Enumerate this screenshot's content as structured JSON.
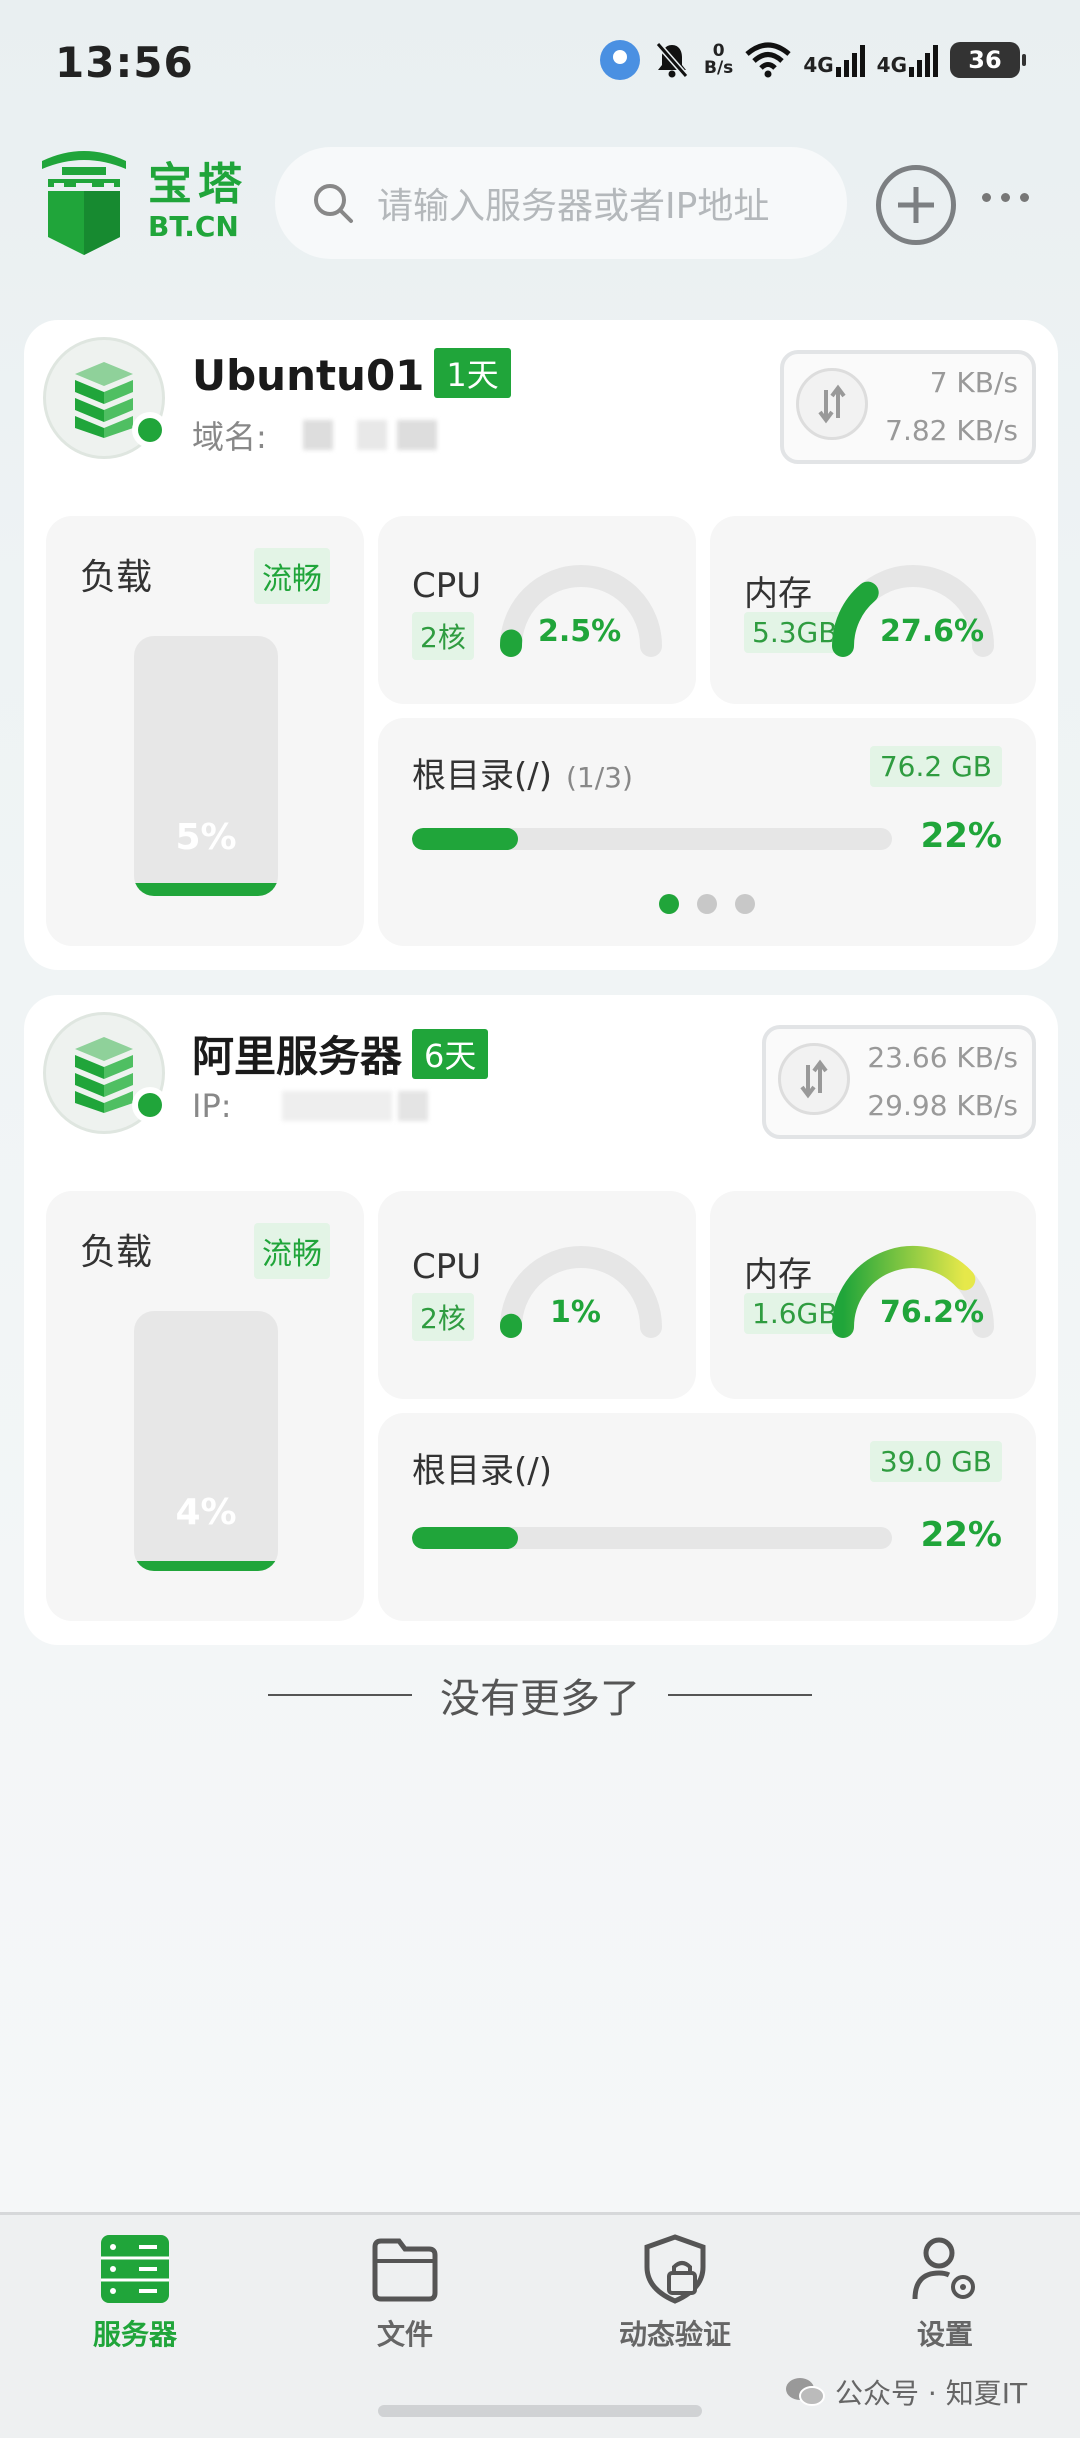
{
  "status_bar": {
    "time": "13:56",
    "net_speed_value": "0",
    "net_speed_unit": "B/s",
    "sim1_label": "4G",
    "sim2_label": "4G",
    "battery": "36"
  },
  "header": {
    "logo_cn": "宝塔",
    "logo_en": "BT.CN",
    "search_placeholder": "请输入服务器或者IP地址"
  },
  "servers": [
    {
      "name": "Ubuntu01",
      "days": "1天",
      "address_label": "域名:",
      "net_up": "7 KB/s",
      "net_down": "7.82 KB/s",
      "load": {
        "title": "负载",
        "status": "流畅",
        "percent": "5%",
        "fraction": 0.05
      },
      "cpu": {
        "title": "CPU",
        "cores": "2核",
        "percent": "2.5%",
        "fraction": 0.025
      },
      "memory": {
        "title": "内存",
        "size": "5.3GB",
        "percent": "27.6%",
        "fraction": 0.276
      },
      "disk": {
        "title": "根目录(/)",
        "page": "(1/3)",
        "size": "76.2 GB",
        "percent": "22%",
        "fraction": 0.22
      }
    },
    {
      "name": "阿里服务器",
      "days": "6天",
      "address_label": "IP:",
      "net_up": "23.66 KB/s",
      "net_down": "29.98 KB/s",
      "load": {
        "title": "负载",
        "status": "流畅",
        "percent": "4%",
        "fraction": 0.04
      },
      "cpu": {
        "title": "CPU",
        "cores": "2核",
        "percent": "1%",
        "fraction": 0.01
      },
      "memory": {
        "title": "内存",
        "size": "1.6GB",
        "percent": "76.2%",
        "fraction": 0.762
      },
      "disk": {
        "title": "根目录(/)",
        "size": "39.0 GB",
        "percent": "22%",
        "fraction": 0.22
      }
    }
  ],
  "footer_text": "没有更多了",
  "bottom_nav": [
    {
      "label": "服务器",
      "icon": "server-icon",
      "active": true
    },
    {
      "label": "文件",
      "icon": "folder-icon",
      "active": false
    },
    {
      "label": "动态验证",
      "icon": "shield-lock-icon",
      "active": false
    },
    {
      "label": "设置",
      "icon": "user-settings-icon",
      "active": false
    }
  ],
  "watermark": "公众号 · 知夏IT",
  "colors": {
    "accent": "#20a53a",
    "gauge_track": "#e6e6e6",
    "gauge_warn": "#e6e84a"
  }
}
